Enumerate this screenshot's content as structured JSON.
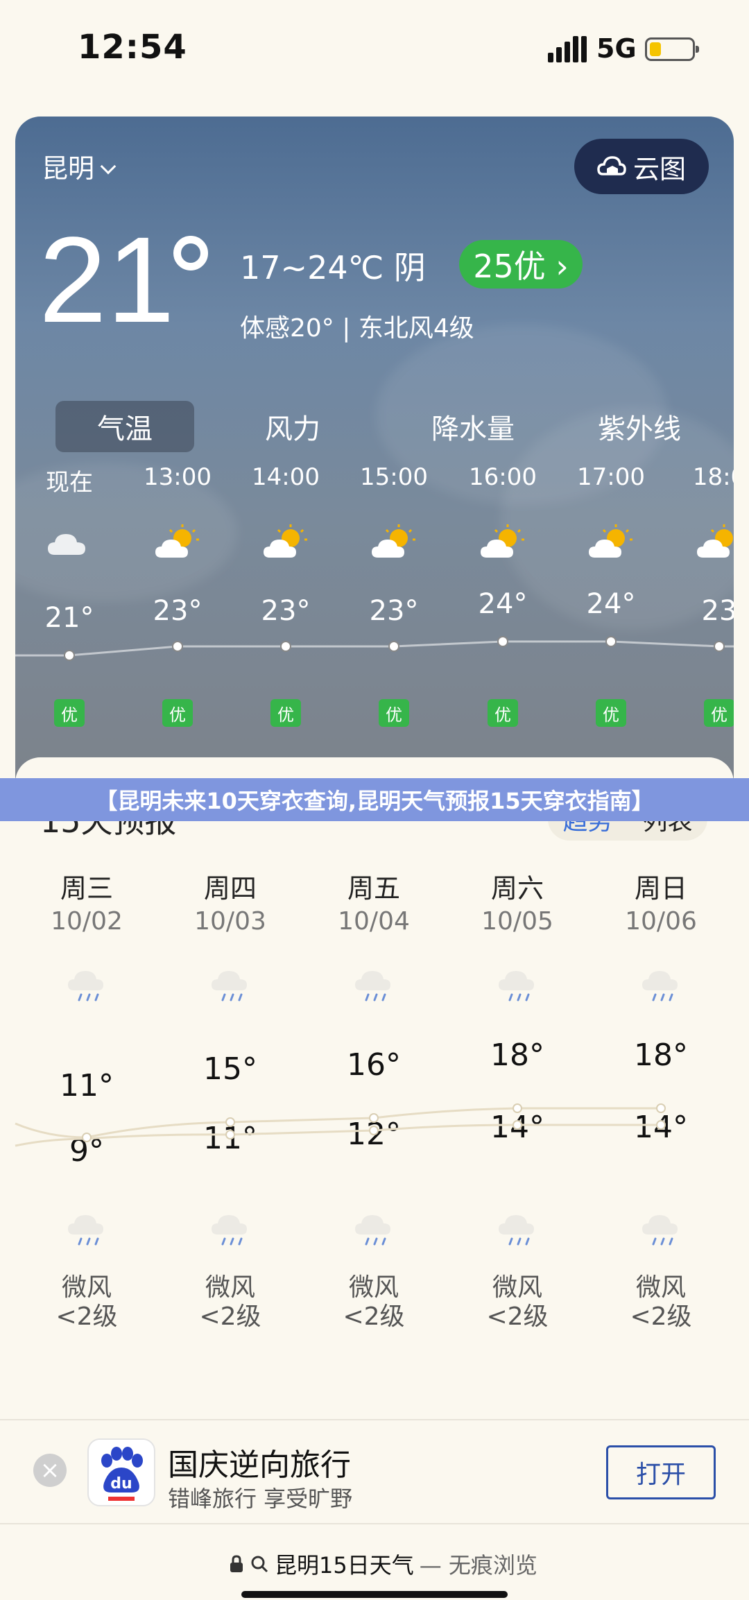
{
  "status": {
    "time": "12:54",
    "network": "5G"
  },
  "weather": {
    "city": "昆明",
    "radar_button": "云图",
    "current_temp": "21",
    "range_condition": "17~24℃ 阴",
    "aqi": "25优 ›",
    "feels_wind": "体感20° | 东北风4级",
    "tabs": [
      "气温",
      "风力",
      "降水量",
      "紫外线"
    ],
    "hourly": [
      {
        "time": "现在",
        "temp": "21°",
        "aq": "优",
        "icon": "cloudy-icon"
      },
      {
        "time": "13:00",
        "temp": "23°",
        "aq": "优",
        "icon": "partly-sunny-icon"
      },
      {
        "time": "14:00",
        "temp": "23°",
        "aq": "优",
        "icon": "partly-sunny-icon"
      },
      {
        "time": "15:00",
        "temp": "23°",
        "aq": "优",
        "icon": "partly-sunny-icon"
      },
      {
        "time": "16:00",
        "temp": "24°",
        "aq": "优",
        "icon": "partly-sunny-icon"
      },
      {
        "time": "17:00",
        "temp": "24°",
        "aq": "优",
        "icon": "partly-sunny-icon"
      },
      {
        "time": "18:0",
        "temp": "23",
        "aq": "优",
        "icon": "partly-sunny-icon"
      }
    ]
  },
  "banner": "【昆明未来10天穿衣查询,昆明天气预报15天穿衣指南】",
  "forecast": {
    "title": "15天预报",
    "view_trend": "趋势",
    "view_list": "列表",
    "days": [
      {
        "day": "周三",
        "date": "10/02",
        "high": "11°",
        "low": "9°",
        "wind": "微风",
        "level": "<2级"
      },
      {
        "day": "周四",
        "date": "10/03",
        "high": "15°",
        "low": "11°",
        "wind": "微风",
        "level": "<2级"
      },
      {
        "day": "周五",
        "date": "10/04",
        "high": "16°",
        "low": "12°",
        "wind": "微风",
        "level": "<2级"
      },
      {
        "day": "周六",
        "date": "10/05",
        "high": "18°",
        "low": "14°",
        "wind": "微风",
        "level": "<2级"
      },
      {
        "day": "周日",
        "date": "10/06",
        "high": "18°",
        "low": "14°",
        "wind": "微风",
        "level": "<2级"
      }
    ]
  },
  "ad": {
    "title": "国庆逆向旅行",
    "subtitle": "错峰旅行 享受旷野",
    "button": "打开",
    "logo_text": "du"
  },
  "search": {
    "query": "昆明15日天气",
    "mode": "— 无痕浏览"
  },
  "colors": {
    "aqi_green": "#36b54a",
    "accent_blue": "#3a6fd8",
    "banner": "#7f96de"
  }
}
